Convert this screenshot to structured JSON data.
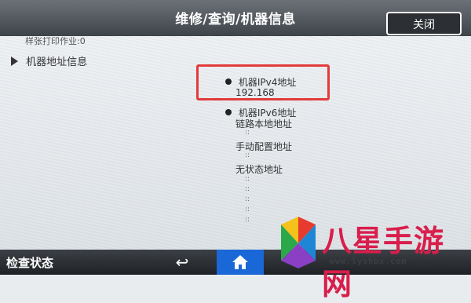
{
  "header": {
    "title": "维修/查询/机器信息",
    "close_label": "关闭"
  },
  "content": {
    "cut_off_text": "样张打印作业:0",
    "section_label": "机器地址信息",
    "ipv4_label": "机器IPv4地址",
    "ipv4_value": "192.168",
    "ipv6_label": "机器IPv6地址",
    "link_local_label": "链路本地地址",
    "manual_config_label": "手动配置地址",
    "stateless_label": "无状态地址",
    "separator": "::"
  },
  "footer": {
    "status_label": "检查状态",
    "back_icon": "back-arrow-icon",
    "home_icon": "home-icon"
  },
  "watermark": {
    "brand_text": "八星手游网",
    "url_text": "www.lyshbx.com"
  },
  "colors": {
    "highlight": "#e23b3b",
    "home_button": "#1a67d8",
    "brand": "#d81e4c"
  }
}
